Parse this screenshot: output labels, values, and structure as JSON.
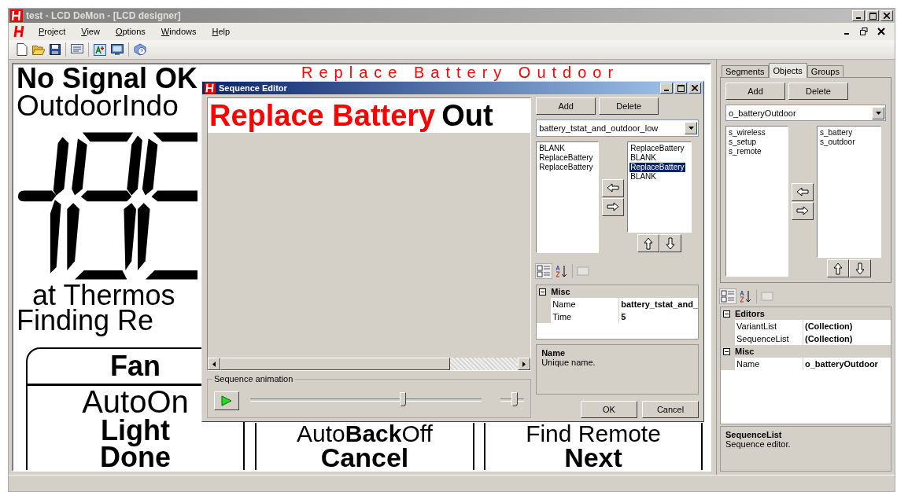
{
  "window": {
    "title": "test - LCD DeMon - [LCD designer]"
  },
  "menu": [
    "Project",
    "View",
    "Options",
    "Windows",
    "Help"
  ],
  "canvas": {
    "labels": [
      {
        "text": "No Signal OK",
        "color": "#000000"
      },
      {
        "text": "Replace Battery Outdoor",
        "color": "#ff0000"
      },
      {
        "text": "OutdoorIndo",
        "color": "#000000"
      },
      {
        "text": "at Thermos",
        "color": "#000000"
      },
      {
        "text": "Finding Re",
        "color": "#000000"
      }
    ],
    "key_columns": [
      {
        "rows": [
          "Fan",
          "AutoOn",
          "Light",
          "Done"
        ]
      },
      {
        "rows": [
          "Auto**Back**Off",
          "Cancel"
        ]
      },
      {
        "rows": [
          "Find Remote",
          "Next"
        ]
      }
    ]
  },
  "dialog": {
    "title": "Sequence Editor",
    "preview": [
      {
        "text": "Replace Battery",
        "color": "#ff0000"
      },
      {
        "text": "Out",
        "color": "#000000"
      }
    ],
    "add": "Add",
    "delete": "Delete",
    "sequence": "battery_tstat_and_outdoor_low",
    "available": [
      {
        "label": "BLANK",
        "selected": false
      },
      {
        "label": "ReplaceBattery",
        "selected": false
      },
      {
        "label": "ReplaceBattery",
        "selected": false
      }
    ],
    "frames": [
      {
        "label": "ReplaceBattery",
        "selected": false
      },
      {
        "label": "BLANK",
        "selected": false
      },
      {
        "label": "ReplaceBattery",
        "selected": true
      },
      {
        "label": "BLANK",
        "selected": false
      }
    ],
    "properties": [
      {
        "name": "Misc",
        "expanded": true,
        "rows": [
          {
            "name": "Name",
            "value": "battery_tstat_and_"
          },
          {
            "name": "Time",
            "value": "5"
          }
        ]
      }
    ],
    "description": {
      "title": "Name",
      "text": "Unique name."
    },
    "animation": {
      "title": "Sequence animation",
      "position": {
        "level": 0.66
      },
      "speed": {
        "level": 0.6
      }
    },
    "buttons": [
      "OK",
      "Cancel"
    ]
  },
  "panel": {
    "tabs": [
      {
        "label": "Segments",
        "selected": false
      },
      {
        "label": "Objects",
        "selected": true
      },
      {
        "label": "Groups",
        "selected": false
      }
    ],
    "add": "Add",
    "delete": "Delete",
    "object": "o_batteryOutdoor",
    "available": [
      {
        "label": "s_wireless",
        "selected": false
      },
      {
        "label": "s_setup",
        "selected": false
      },
      {
        "label": "s_remote",
        "selected": false
      }
    ],
    "assigned": [
      {
        "label": "s_battery",
        "selected": false
      },
      {
        "label": "s_outdoor",
        "selected": false
      }
    ],
    "properties": [
      {
        "name": "Editors",
        "expanded": true,
        "rows": [
          {
            "name": "VariantList",
            "value": "(Collection)"
          },
          {
            "name": "SequenceList",
            "value": "(Collection)"
          }
        ]
      },
      {
        "name": "Misc",
        "expanded": true,
        "rows": [
          {
            "name": "Name",
            "value": "o_batteryOutdoor"
          }
        ]
      }
    ],
    "description": {
      "title": "SequenceList",
      "text": "Sequence editor."
    }
  }
}
